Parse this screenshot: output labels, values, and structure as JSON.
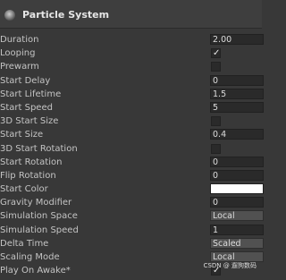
{
  "header": {
    "title": "Particle System",
    "icon": "particle-system-icon"
  },
  "properties": [
    {
      "label": "Duration",
      "type": "number",
      "value": "2.00"
    },
    {
      "label": "Looping",
      "type": "checkbox",
      "checked": true
    },
    {
      "label": "Prewarm",
      "type": "checkbox",
      "checked": false
    },
    {
      "label": "Start Delay",
      "type": "number",
      "value": "0"
    },
    {
      "label": "Start Lifetime",
      "type": "number",
      "value": "1.5"
    },
    {
      "label": "Start Speed",
      "type": "number",
      "value": "5"
    },
    {
      "label": "3D Start Size",
      "type": "checkbox",
      "checked": false
    },
    {
      "label": "Start Size",
      "type": "number",
      "value": "0.4"
    },
    {
      "label": "3D Start Rotation",
      "type": "checkbox",
      "checked": false
    },
    {
      "label": "Start Rotation",
      "type": "number",
      "value": "0"
    },
    {
      "label": "Flip Rotation",
      "type": "number",
      "value": "0"
    },
    {
      "label": "Start Color",
      "type": "color",
      "color": "#ffffff"
    },
    {
      "label": "Gravity Modifier",
      "type": "number",
      "value": "0"
    },
    {
      "label": "Simulation Space",
      "type": "dropdown",
      "value": "Local"
    },
    {
      "label": "Simulation Speed",
      "type": "number",
      "value": "1"
    },
    {
      "label": "Delta Time",
      "type": "dropdown",
      "value": "Scaled"
    },
    {
      "label": "Scaling Mode",
      "type": "dropdown",
      "value": "Local"
    },
    {
      "label": "Play On Awake*",
      "type": "checkbox",
      "checked": true
    }
  ],
  "watermark": "CSDN @ 遛狗数码"
}
